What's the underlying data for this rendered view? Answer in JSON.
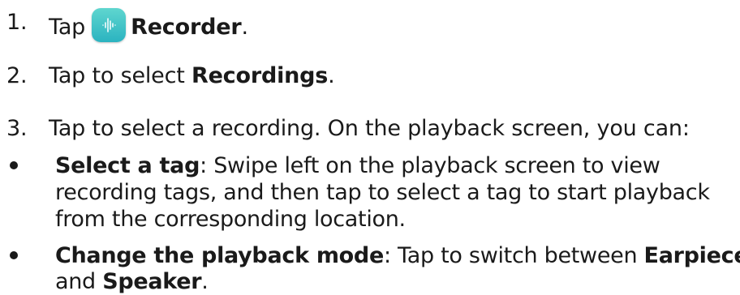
{
  "steps": [
    {
      "number": "1.",
      "prefix": "Tap",
      "bold": "Recorder",
      "suffix": "."
    },
    {
      "number": "2.",
      "prefix": "Tap to select ",
      "bold": "Recordings",
      "suffix": "."
    },
    {
      "number": "3.",
      "text": "Tap to select a recording. On the playback screen, you can:"
    }
  ],
  "bullets": [
    {
      "bold": "Select a tag",
      "lines": [
        ": Swipe left on the playback screen to view",
        "recording tags, and then tap to select a tag to start playback",
        "from the corresponding location."
      ]
    },
    {
      "bold": "Change the playback mode",
      "line1_rest": ": Tap to switch between ",
      "earpiece": "Earpiece",
      "line2_prefix": "and ",
      "speaker": "Speaker",
      "line2_suffix": "."
    }
  ],
  "icons": {
    "recorder": "recorder-app-icon"
  },
  "colors": {
    "text": "#1a1a1a",
    "icon_top": "#5fd6cf",
    "icon_bottom": "#2bb3c0"
  }
}
